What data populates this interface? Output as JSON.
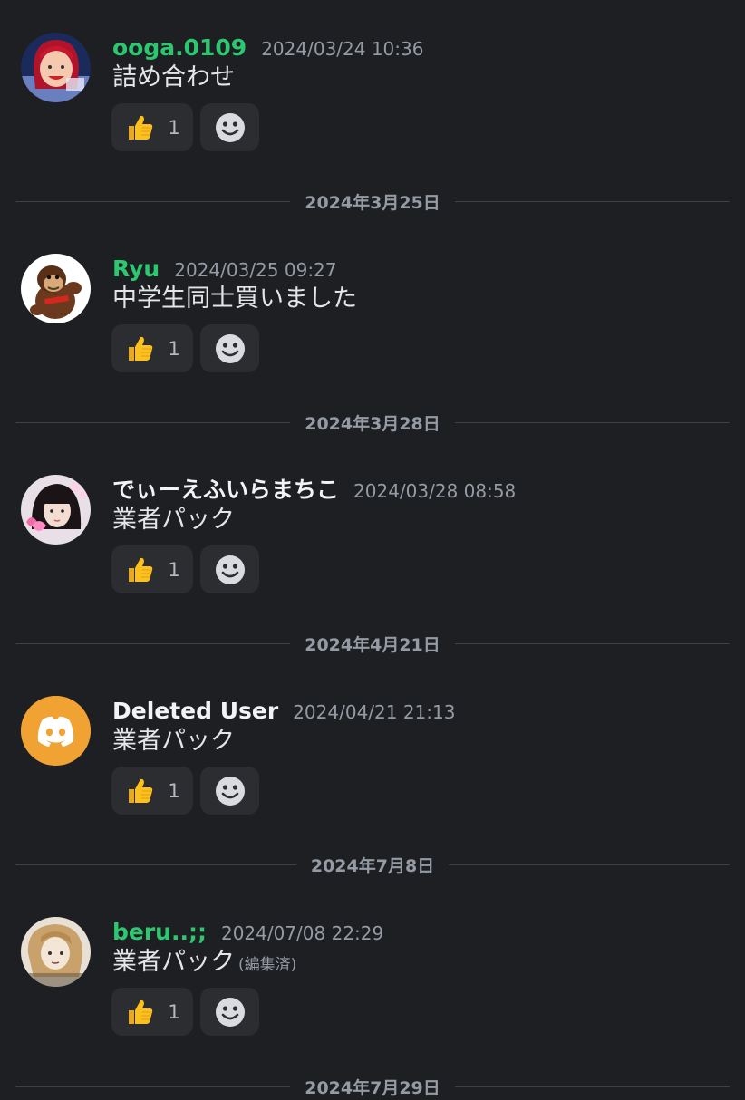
{
  "messages": [
    {
      "username": "ooga.0109",
      "username_color": "#2dc770",
      "timestamp": "2024/03/24 10:36",
      "content": "詰め合わせ",
      "reaction": {
        "emoji": "thumbs-up",
        "count": "1"
      }
    },
    {
      "username": "Ryu",
      "username_color": "#2dc770",
      "timestamp": "2024/03/25 09:27",
      "content": "中学生同士買いました",
      "reaction": {
        "emoji": "thumbs-up",
        "count": "1"
      }
    },
    {
      "username": "でぃーえふいらまちこ",
      "username_color": "#f2f3f5",
      "timestamp": "2024/03/28 08:58",
      "content": "業者パック",
      "reaction": {
        "emoji": "thumbs-up",
        "count": "1"
      }
    },
    {
      "username": "Deleted User",
      "username_color": "#f2f3f5",
      "timestamp": "2024/04/21 21:13",
      "content": "業者パック",
      "reaction": {
        "emoji": "thumbs-up",
        "count": "1"
      }
    },
    {
      "username": "beru..;;",
      "username_color": "#2dc770",
      "timestamp": "2024/07/08 22:29",
      "content": "業者パック",
      "edited": "(編集済)",
      "reaction": {
        "emoji": "thumbs-up",
        "count": "1"
      }
    }
  ],
  "dividers": [
    "2024年3月25日",
    "2024年3月28日",
    "2024年4月21日",
    "2024年7月8日",
    "2024年7月29日"
  ],
  "icons": {
    "reaction": "thumbs-up-emoji",
    "add_reaction": "smiley-face-icon",
    "deleted_user_avatar": "discord-logo-icon"
  },
  "colors": {
    "background": "#1e1f22",
    "reaction_background": "#2b2d31",
    "deleted_user_avatar": "#f0a232"
  }
}
